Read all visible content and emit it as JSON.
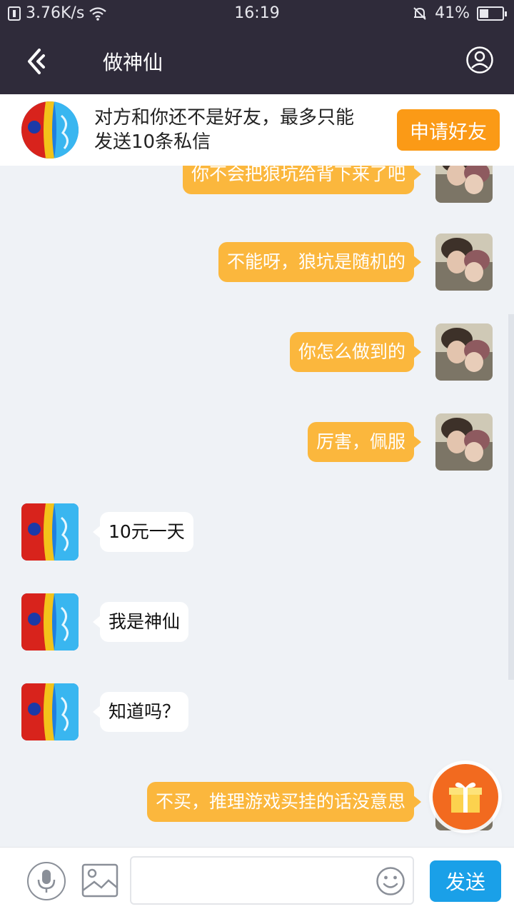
{
  "status_bar": {
    "speed": "3.76K/s",
    "time": "16:19",
    "battery_text": "41%",
    "battery_level": 0.41
  },
  "nav": {
    "title": "做神仙"
  },
  "banner": {
    "line1": "对方和你还不是好友，最多只能",
    "line2": "发送10条私信",
    "button_label": "申请好友"
  },
  "messages": [
    {
      "side": "out",
      "text": "你不会把狼坑给背下来了吧"
    },
    {
      "side": "out",
      "text": "不能呀，狼坑是随机的"
    },
    {
      "side": "out",
      "text": "你怎么做到的"
    },
    {
      "side": "out",
      "text": "厉害，佩服"
    },
    {
      "side": "in",
      "text": "10元一天"
    },
    {
      "side": "in",
      "text": "我是神仙"
    },
    {
      "side": "in",
      "text": "知道吗？"
    },
    {
      "side": "out",
      "text": "不买，推理游戏买挂的话没意思"
    }
  ],
  "input": {
    "send_label": "发送",
    "placeholder": ""
  },
  "colors": {
    "header_bg": "#2f2b3a",
    "outgoing_bubble": "#fbb73d",
    "add_friend_button": "#fb9a16",
    "send_button": "#1aa0e8",
    "gift_button": "#f26a1f"
  },
  "icons": [
    "back-icon",
    "profile-icon",
    "microphone-icon",
    "image-icon",
    "emoji-icon",
    "gift-icon",
    "wifi-icon",
    "mute-bell-icon",
    "battery-icon"
  ]
}
